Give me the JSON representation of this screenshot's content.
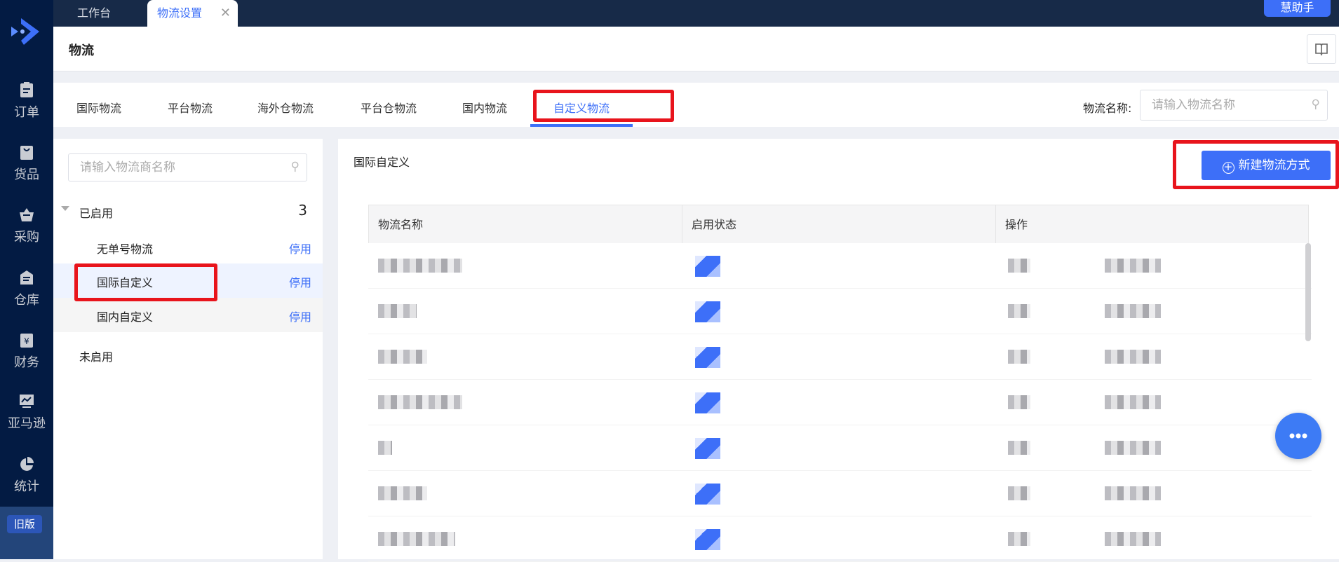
{
  "sidebar": {
    "items": [
      {
        "label": "订单",
        "icon": "order-icon"
      },
      {
        "label": "货品",
        "icon": "goods-icon"
      },
      {
        "label": "采购",
        "icon": "purchase-icon"
      },
      {
        "label": "仓库",
        "icon": "warehouse-icon"
      },
      {
        "label": "财务",
        "icon": "finance-icon"
      },
      {
        "label": "亚马逊",
        "icon": "amazon-icon"
      },
      {
        "label": "统计",
        "icon": "stats-icon"
      }
    ],
    "old_version": "旧版"
  },
  "topbar": {
    "tabs": [
      {
        "label": "工作台"
      },
      {
        "label": "物流设置"
      }
    ],
    "helper": "慧助手"
  },
  "header": {
    "title": "物流"
  },
  "tabs": [
    {
      "label": "国际物流"
    },
    {
      "label": "平台物流"
    },
    {
      "label": "海外仓物流"
    },
    {
      "label": "平台仓物流"
    },
    {
      "label": "国内物流"
    },
    {
      "label": "自定义物流"
    }
  ],
  "filter": {
    "label": "物流名称:",
    "placeholder": "请输入物流名称"
  },
  "left": {
    "search_placeholder": "请输入物流商名称",
    "enabled_group": "已启用",
    "enabled_count": "3",
    "items": [
      {
        "label": "无单号物流",
        "action": "停用"
      },
      {
        "label": "国际自定义",
        "action": "停用"
      },
      {
        "label": "国内自定义",
        "action": "停用"
      }
    ],
    "disabled_group": "未启用"
  },
  "main": {
    "title": "国际自定义",
    "new_button": "新建物流方式",
    "columns": [
      "物流名称",
      "启用状态",
      "操作"
    ]
  },
  "colors": {
    "accent": "#3d6ff8",
    "sidebar": "#031b43",
    "highlight": "#e8141c"
  }
}
